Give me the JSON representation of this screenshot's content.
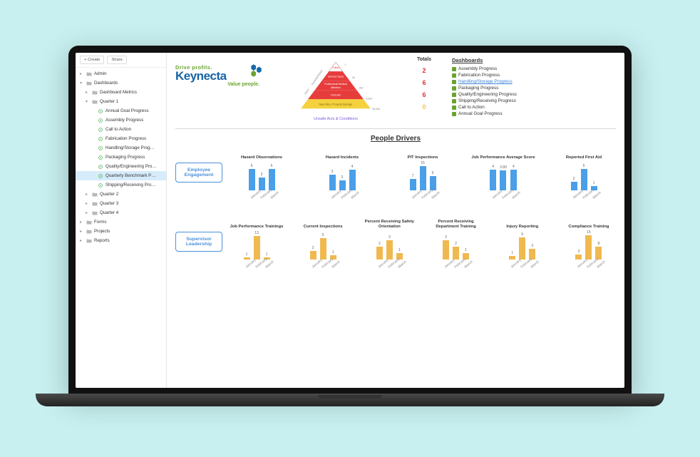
{
  "sidebar": {
    "create_label": "+  Create",
    "share_label": "Share",
    "tree": [
      {
        "level": 0,
        "icon": "folder",
        "caret": "▸",
        "label": "Admin",
        "selected": false
      },
      {
        "level": 0,
        "icon": "folder",
        "caret": "▾",
        "label": "Dashboards",
        "selected": false
      },
      {
        "level": 1,
        "icon": "folder",
        "caret": "▸",
        "label": "Dashboard Metrics",
        "selected": false
      },
      {
        "level": 1,
        "icon": "folder",
        "caret": "▾",
        "label": "Quarter 1",
        "selected": false
      },
      {
        "level": 2,
        "icon": "gear",
        "caret": "",
        "label": "Annual Goal Progress",
        "selected": false
      },
      {
        "level": 2,
        "icon": "gear",
        "caret": "",
        "label": "Assembly Progress",
        "selected": false
      },
      {
        "level": 2,
        "icon": "gear",
        "caret": "",
        "label": "Call to Action",
        "selected": false
      },
      {
        "level": 2,
        "icon": "gear",
        "caret": "",
        "label": "Fabrication Progress",
        "selected": false
      },
      {
        "level": 2,
        "icon": "gear",
        "caret": "",
        "label": "Handling/Storage Prog…",
        "selected": false
      },
      {
        "level": 2,
        "icon": "gear",
        "caret": "",
        "label": "Packaging Progress",
        "selected": false
      },
      {
        "level": 2,
        "icon": "gear",
        "caret": "",
        "label": "Quality/Engineering Pro…",
        "selected": false
      },
      {
        "level": 2,
        "icon": "gear",
        "caret": "",
        "label": "Quarterly Benchmark P…",
        "selected": true
      },
      {
        "level": 2,
        "icon": "gear",
        "caret": "",
        "label": "Shipping/Receiving Pro…",
        "selected": false
      },
      {
        "level": 1,
        "icon": "folder",
        "caret": "▸",
        "label": "Quarter 2",
        "selected": false
      },
      {
        "level": 1,
        "icon": "folder",
        "caret": "▸",
        "label": "Quarter 3",
        "selected": false
      },
      {
        "level": 1,
        "icon": "folder",
        "caret": "▸",
        "label": "Quarter 4",
        "selected": false
      },
      {
        "level": 0,
        "icon": "folder",
        "caret": "▸",
        "label": "Forms",
        "selected": false
      },
      {
        "level": 0,
        "icon": "folder",
        "caret": "▸",
        "label": "Projects",
        "selected": false
      },
      {
        "level": 0,
        "icon": "folder",
        "caret": "▸",
        "label": "Reports",
        "selected": false
      }
    ]
  },
  "logo": {
    "line1": "Drive profits.",
    "line2": "Keynecta",
    "line3": "Value people."
  },
  "pyramid": {
    "side_label_left": "Injury",
    "side_label_right": "Severity/Impact",
    "levels": [
      {
        "text": "Fatal",
        "bg": "#ffffff",
        "txt": "#d33"
      },
      {
        "text": "Serious Injury",
        "bg": "#e73c3c",
        "txt": "#fff"
      },
      {
        "text": "Professional Medical Attention",
        "bg": "#e73c3c",
        "txt": "#fff"
      },
      {
        "text": "First Aid",
        "bg": "#e73c3c",
        "txt": "#fff"
      },
      {
        "text": "Near Miss, Property Damage",
        "bg": "#f4d13d",
        "txt": "#7a5e0c"
      }
    ],
    "axis": [
      "1",
      "30",
      "300",
      "3,000",
      "30,000"
    ],
    "caption": "Unsafe Acts & Conditions"
  },
  "totals": {
    "title": "Totals",
    "items": [
      {
        "value": "2",
        "color": "#d33"
      },
      {
        "value": "6",
        "color": "#d33"
      },
      {
        "value": "6",
        "color": "#d33"
      },
      {
        "value": "0",
        "color": "#f4c63d"
      }
    ]
  },
  "dashboards": {
    "title": "Dashboards",
    "items": [
      {
        "label": "Assembly Progress",
        "color": "#6aa32f",
        "active": false
      },
      {
        "label": "Fabrication Progress",
        "color": "#6aa32f",
        "active": false
      },
      {
        "label": "Handling/Storage Progress",
        "color": "#6aa32f",
        "active": true
      },
      {
        "label": "Packaging Progress",
        "color": "#6aa32f",
        "active": false
      },
      {
        "label": "Quality/Engineering Progress",
        "color": "#6aa32f",
        "active": false
      },
      {
        "label": "Shipping/Receiving Progress",
        "color": "#6aa32f",
        "active": false
      },
      {
        "label": "Call to Action",
        "color": "#6aa32f",
        "active": false
      },
      {
        "label": "Annual Goal Progress",
        "color": "#6aa32f",
        "active": false
      }
    ]
  },
  "people_drivers": {
    "title": "People Drivers",
    "rows": [
      {
        "label": "Employee Engagement",
        "color": "blue",
        "charts": [
          {
            "title": "Hazard Observations",
            "max": 6,
            "data": [
              5,
              3,
              5
            ]
          },
          {
            "title": "Hazard Incidents",
            "max": 5,
            "data": [
              3,
              2,
              4
            ]
          },
          {
            "title": "PIT Inspections",
            "max": 16,
            "data": [
              7,
              15,
              9
            ]
          },
          {
            "title": "Job Performance Average Score",
            "max": 5,
            "data": [
              4.0,
              3.89,
              4.0
            ]
          },
          {
            "title": "Reported First Aid",
            "max": 6,
            "data": [
              2,
              5,
              1
            ]
          }
        ]
      },
      {
        "label": "Supervisor Leadership",
        "color": "orange",
        "charts": [
          {
            "title": "Job Performance Trainings",
            "max": 14,
            "data": [
              1,
              13,
              1
            ]
          },
          {
            "title": "Current Inspections",
            "max": 6,
            "data": [
              2,
              5,
              1
            ]
          },
          {
            "title": "Percent Receiving Safety Orientation",
            "max": 4,
            "data": [
              2,
              3,
              1
            ]
          },
          {
            "title": "Percent Receiving Department Training",
            "max": 4,
            "data": [
              3,
              2,
              1
            ]
          },
          {
            "title": "Injury Reporting",
            "max": 7,
            "data": [
              1,
              6,
              3
            ]
          },
          {
            "title": "Compliance Training",
            "max": 16,
            "data": [
              3,
              15,
              8
            ]
          }
        ]
      }
    ],
    "months": [
      "January",
      "February",
      "March"
    ]
  },
  "chart_data": [
    {
      "type": "bar",
      "title": "Hazard Observations",
      "categories": [
        "January",
        "February",
        "March"
      ],
      "values": [
        5,
        3,
        5
      ],
      "ylim": [
        0,
        6
      ]
    },
    {
      "type": "bar",
      "title": "Hazard Incidents",
      "categories": [
        "January",
        "February",
        "March"
      ],
      "values": [
        3,
        2,
        4
      ],
      "ylim": [
        0,
        5
      ]
    },
    {
      "type": "bar",
      "title": "PIT Inspections",
      "categories": [
        "January",
        "February",
        "March"
      ],
      "values": [
        7,
        15,
        9
      ],
      "ylim": [
        0,
        16
      ]
    },
    {
      "type": "bar",
      "title": "Job Performance Average Score",
      "categories": [
        "January",
        "February",
        "March"
      ],
      "values": [
        4.0,
        3.89,
        4.0
      ],
      "ylim": [
        0,
        5
      ]
    },
    {
      "type": "bar",
      "title": "Reported First Aid",
      "categories": [
        "January",
        "February",
        "March"
      ],
      "values": [
        2,
        5,
        1
      ],
      "ylim": [
        0,
        6
      ]
    },
    {
      "type": "bar",
      "title": "Job Performance Trainings",
      "categories": [
        "January",
        "February",
        "March"
      ],
      "values": [
        1,
        13,
        1
      ],
      "ylim": [
        0,
        14
      ]
    },
    {
      "type": "bar",
      "title": "Current Inspections",
      "categories": [
        "January",
        "February",
        "March"
      ],
      "values": [
        2,
        5,
        1
      ],
      "ylim": [
        0,
        6
      ]
    },
    {
      "type": "bar",
      "title": "Percent Receiving Safety Orientation",
      "categories": [
        "January",
        "February",
        "March"
      ],
      "values": [
        2,
        3,
        1
      ],
      "ylim": [
        0,
        4
      ]
    },
    {
      "type": "bar",
      "title": "Percent Receiving Department Training",
      "categories": [
        "January",
        "February",
        "March"
      ],
      "values": [
        3,
        2,
        1
      ],
      "ylim": [
        0,
        4
      ]
    },
    {
      "type": "bar",
      "title": "Injury Reporting",
      "categories": [
        "January",
        "February",
        "March"
      ],
      "values": [
        1,
        6,
        3
      ],
      "ylim": [
        0,
        7
      ]
    },
    {
      "type": "bar",
      "title": "Compliance Training",
      "categories": [
        "January",
        "February",
        "March"
      ],
      "values": [
        3,
        15,
        8
      ],
      "ylim": [
        0,
        16
      ]
    }
  ]
}
